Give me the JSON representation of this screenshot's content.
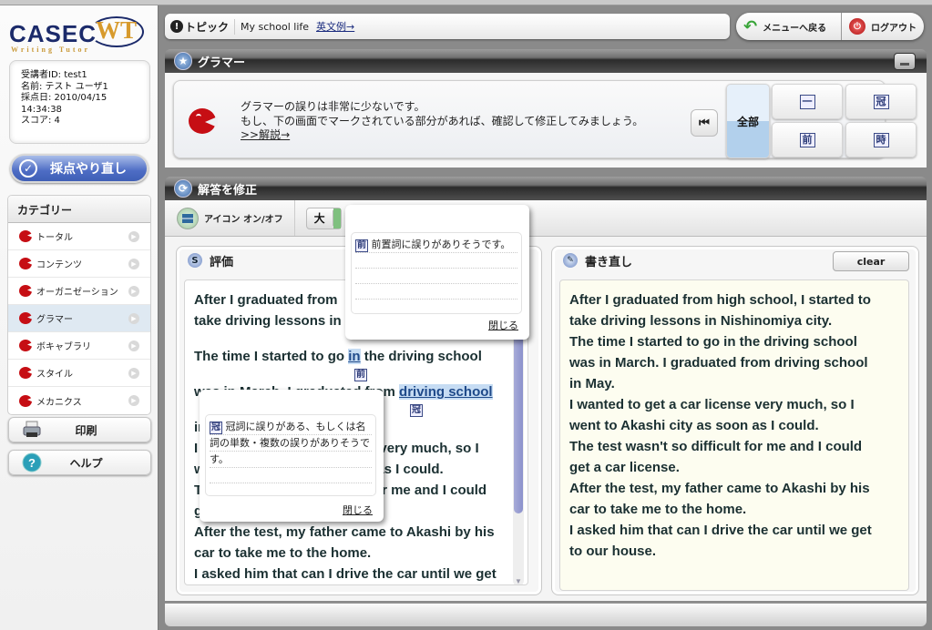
{
  "app": {
    "logo_main": "CASEC",
    "logo_wt": "WT",
    "logo_sub": "Writing Tutor"
  },
  "user": {
    "id_line": "受講者ID: test1",
    "name_line": "名前: テスト ユーザ1",
    "date_line": "採点日: 2010/04/15",
    "time_line": "14:34:38",
    "score_line": "スコア: 4"
  },
  "sidebar": {
    "redo_label": "採点やり直し",
    "category_title": "カテゴリー",
    "categories": [
      {
        "label": "トータル",
        "active": false
      },
      {
        "label": "コンテンツ",
        "active": false
      },
      {
        "label": "オーガニゼーション",
        "active": false
      },
      {
        "label": "グラマー",
        "active": true
      },
      {
        "label": "ボキャブラリ",
        "active": false
      },
      {
        "label": "スタイル",
        "active": false
      },
      {
        "label": "メカニクス",
        "active": false
      }
    ],
    "print_label": "印刷",
    "help_label": "ヘルプ"
  },
  "topic": {
    "label": "トピック",
    "value": "My school life",
    "example_link": "英文例→"
  },
  "nav": {
    "back_label": "メニューへ戻る",
    "logout_label": "ログアウト"
  },
  "grammar_panel": {
    "title": "グラマー",
    "message_line1": "グラマーの誤りは非常に少ないです。",
    "message_line2": "もし、下の画面でマークされている部分があれば、確認して修正してみましょう。",
    "explain_link": ">>解説→",
    "filters": {
      "all": "全部",
      "k1": "一",
      "k2": "冠",
      "k3": "前",
      "k4": "時"
    }
  },
  "fix_panel": {
    "title": "解答を修正",
    "icon_toggle_label": "アイコン オン/オフ",
    "size_label": "大",
    "eval": {
      "title": "評価",
      "p1_line1": "After I graduated from",
      "p1_line2": "take driving lessons in",
      "p2_pre": "The time I started to go ",
      "p2_hl": "in",
      "p2_post": " the driving school",
      "mark_prep": "前",
      "p3_pre": "was in March. I graduated from ",
      "p3_hl": "driving school",
      "mark_art": "冠",
      "l4": "in May.",
      "l5": "I wanted to get a car license very much, so I",
      "l6": "went to Akashi city as soon as I could.",
      "l7": "The test wasn't so difficult for me and I could",
      "l8": "get a car license.",
      "l9": "After the test, my father came to Akashi by his",
      "l10": "car to take me to the home.",
      "l11": "I asked him that can I drive the car until we get"
    },
    "rewrite": {
      "title": "書き直し",
      "clear_label": "clear",
      "lines": [
        "After I graduated from high school, I started to",
        "take driving lessons in Nishinomiya city.",
        "The time I started to go in the driving school",
        "was in March. I graduated from driving school",
        "in May.",
        "I wanted to get a car license very much, so I",
        "went to Akashi city as soon as I could.",
        "The test wasn't so difficult for me and I could",
        "get a car license.",
        "After the test, my father came to Akashi by his",
        "car to take me to the home.",
        "I asked him that can I drive the car until we get",
        "to our house."
      ]
    }
  },
  "popups": {
    "prep": {
      "badge": "前",
      "text": "前置詞に誤りがありそうです。",
      "close": "閉じる"
    },
    "article": {
      "badge": "冠",
      "text1": "冠詞に誤りがある、もしくは名",
      "text2": "詞の単数・複数の誤りがありそうで",
      "text3": "す。",
      "close": "閉じる"
    }
  }
}
